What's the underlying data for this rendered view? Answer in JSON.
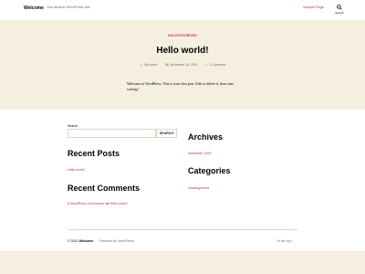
{
  "header": {
    "site_title": "Welcome",
    "site_description": "Just another WordPress site",
    "nav_link": "Sample Page",
    "search_label": "Search"
  },
  "post": {
    "category": "UNCATEGORIZED",
    "title": "Hello world!",
    "author": "By admin",
    "date": "November 18, 2021",
    "comments": "1 Comment",
    "content": "Welcome to WordPress. This is your first post. Edit or delete it, then start writing!"
  },
  "widgets": {
    "search_label": "Search",
    "search_button": "SEARCH",
    "recent_posts_title": "Recent Posts",
    "recent_posts": [
      "Hello world!"
    ],
    "recent_comments_title": "Recent Comments",
    "recent_comment_author": "A WordPress Commenter",
    "recent_comment_on": "on",
    "recent_comment_post": "Hello world!",
    "archives_title": "Archives",
    "archives": [
      "November 2021"
    ],
    "categories_title": "Categories",
    "categories": [
      "Uncategorized"
    ]
  },
  "footer": {
    "copyright_year": "© 2021",
    "copyright_site": "Welcome",
    "powered_by": "Powered by WordPress",
    "to_top": "To the top ↑"
  },
  "colors": {
    "accent": "#cd2653",
    "background": "#f5efe0",
    "secondary_text": "#6d6d6d"
  }
}
